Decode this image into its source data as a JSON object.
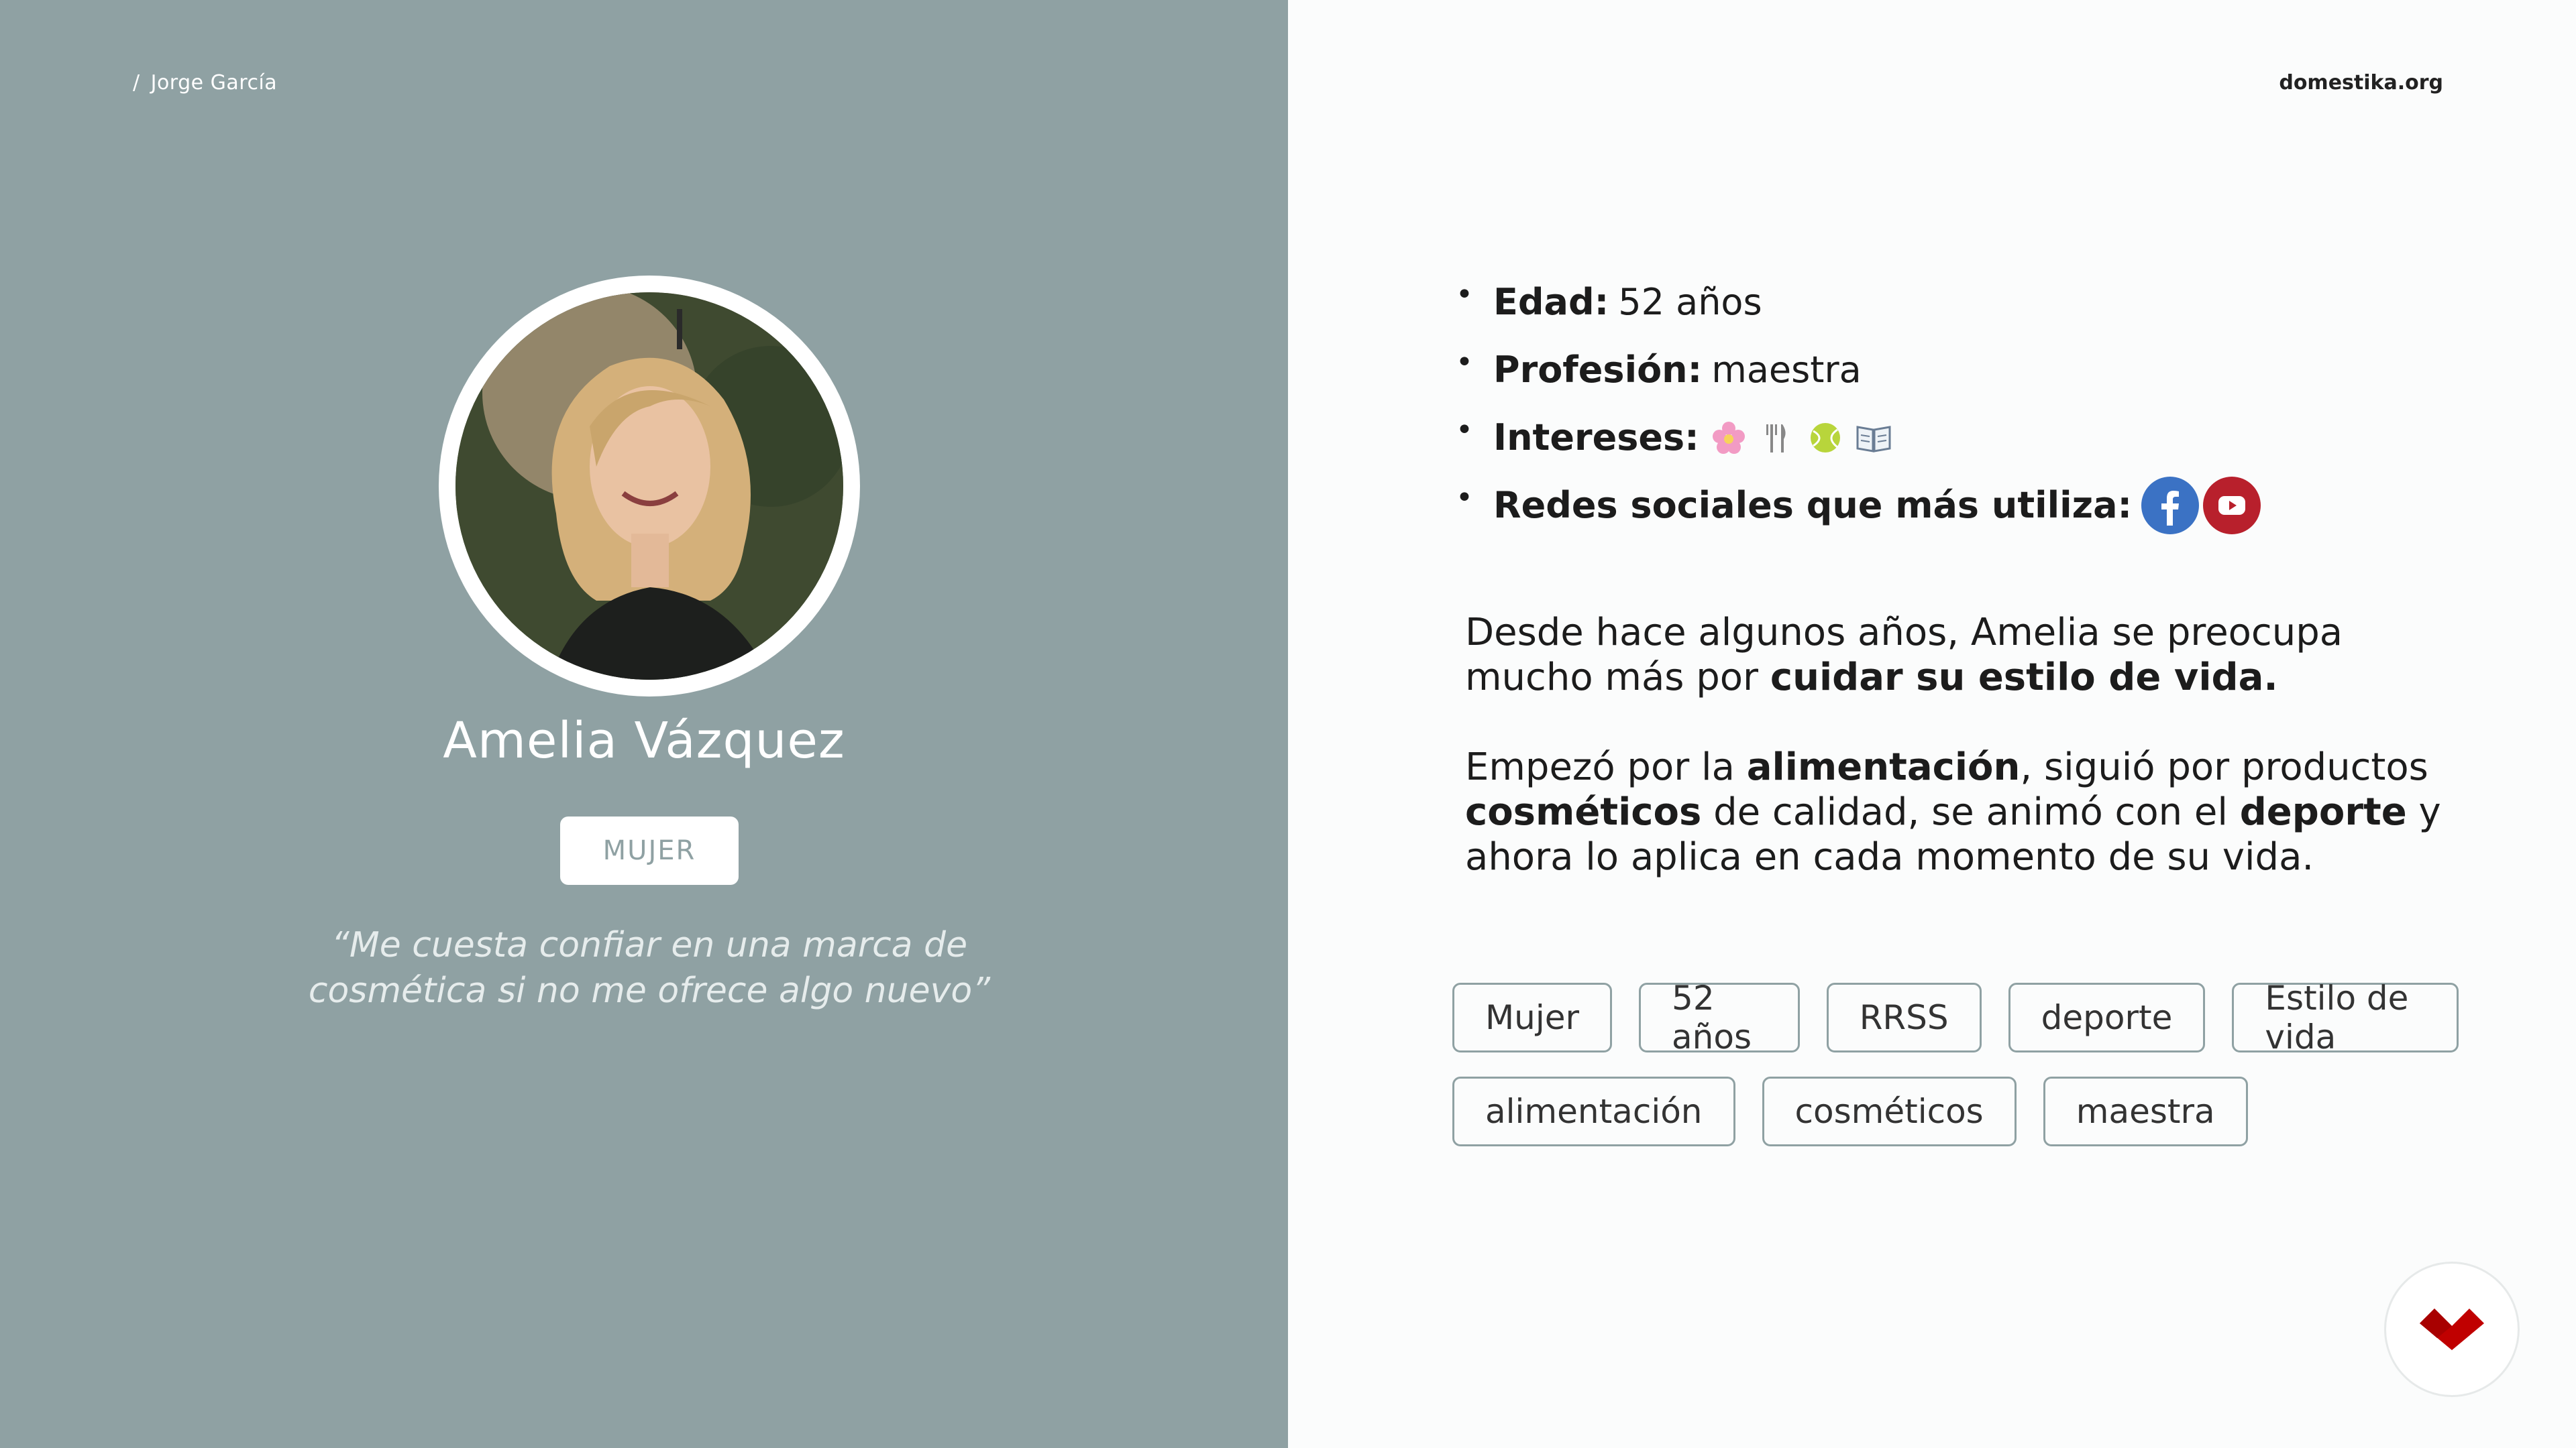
{
  "header": {
    "breadcrumb_sep": "/",
    "author": "Jorge García",
    "brand": "domestika.org"
  },
  "profile": {
    "name": "Amelia Vázquez",
    "gender_badge": "MUJER",
    "quote_line1": "“Me cuesta confiar en una marca de",
    "quote_line2": "cosmética si no me ofrece algo nuevo”"
  },
  "facts": {
    "age_label": "Edad:",
    "age_value": "52 años",
    "profession_label": "Profesión:",
    "profession_value": "maestra",
    "interests_label": "Intereses:",
    "interests_icons": [
      "flower-icon",
      "fork-knife-icon",
      "tennis-ball-icon",
      "book-icon"
    ],
    "social_label": "Redes sociales que más utiliza:",
    "social_icons": [
      "facebook-icon",
      "youtube-icon"
    ]
  },
  "bio": {
    "p1_a": "Desde hace algunos años, Amelia se preocupa mucho más por ",
    "p1_b": "cuidar su estilo de vida.",
    "p2_a": "Empezó por la ",
    "p2_b": "alimentación",
    "p2_c": ", siguió por productos ",
    "p2_d": "cosméticos",
    "p2_e": " de calidad, se animó con el ",
    "p2_f": "deporte",
    "p2_g": " y ahora lo aplica en cada momento de su vida."
  },
  "tags": {
    "row1": [
      "Mujer",
      "52 años",
      "RRSS",
      "deporte",
      "Estilo de vida"
    ],
    "row2": [
      "alimentación",
      "cosméticos",
      "maestra"
    ]
  },
  "colors": {
    "left_panel": "#8fa1a3",
    "right_panel": "#fbfcfc",
    "facebook": "#3b72c4",
    "youtube": "#b8202c",
    "brand_logo": "#c00000"
  }
}
